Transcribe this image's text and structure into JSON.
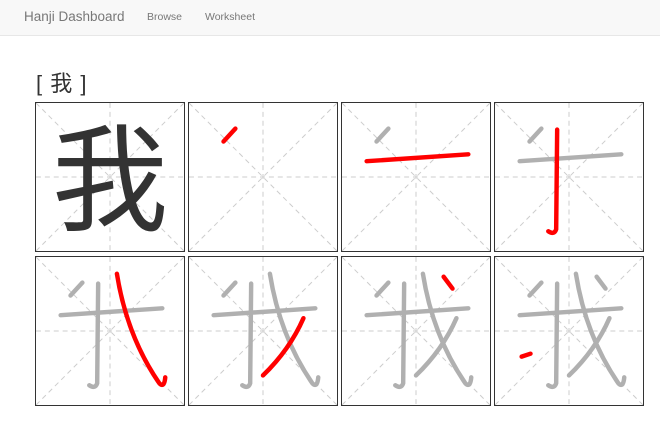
{
  "navbar": {
    "brand": "Hanji Dashboard",
    "links": [
      "Browse",
      "Worksheet"
    ]
  },
  "page": {
    "title": "[ 我 ]"
  },
  "character": "我",
  "colors": {
    "full_character": "#333333",
    "current_stroke": "#ff0000",
    "previous_strokes": "#b0b0b0",
    "guide_lines": "#cccccc"
  },
  "stroke_order": {
    "total_strokes": 7,
    "cells": [
      {
        "step": 0,
        "label": "full"
      },
      {
        "step": 1
      },
      {
        "step": 2
      },
      {
        "step": 3
      },
      {
        "step": 4
      },
      {
        "step": 5
      },
      {
        "step": 6
      },
      {
        "step": 7
      }
    ]
  }
}
